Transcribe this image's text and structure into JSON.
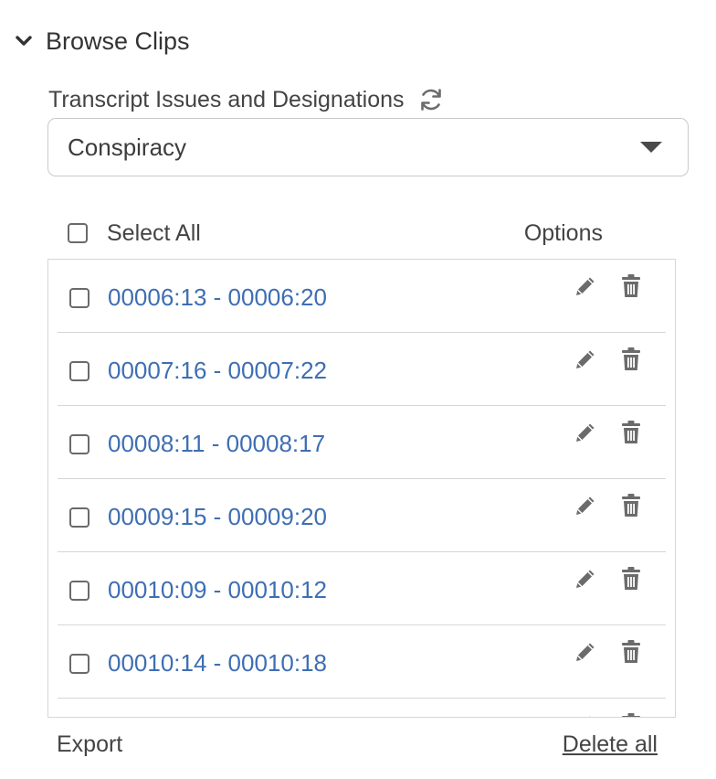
{
  "section": {
    "title": "Browse Clips",
    "icon": "chevron-down-icon"
  },
  "filter": {
    "label": "Transcript Issues and Designations",
    "refresh_icon": "refresh-icon",
    "selected": "Conspiracy"
  },
  "list_header": {
    "select_all_label": "Select All",
    "options_label": "Options"
  },
  "clips": [
    {
      "range": "00006:13 - 00006:20"
    },
    {
      "range": "00007:16 - 00007:22"
    },
    {
      "range": "00008:11 - 00008:17"
    },
    {
      "range": "00009:15 - 00009:20"
    },
    {
      "range": "00010:09 - 00010:12"
    },
    {
      "range": "00010:14 - 00010:18"
    }
  ],
  "footer": {
    "export_label": "Export",
    "delete_all_label": "Delete all"
  },
  "colors": {
    "link": "#3e6eb3",
    "icon": "#6b6b6b",
    "border": "#d4d6dc"
  }
}
